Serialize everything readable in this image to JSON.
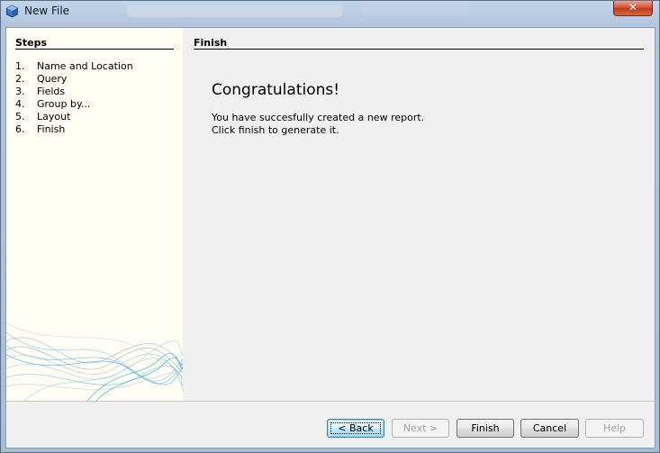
{
  "window": {
    "title": "New File",
    "close_symbol": "✕"
  },
  "steps": {
    "title": "Steps",
    "items": [
      {
        "num": "1.",
        "label": "Name and Location"
      },
      {
        "num": "2.",
        "label": "Query"
      },
      {
        "num": "3.",
        "label": "Fields"
      },
      {
        "num": "4.",
        "label": "Group by..."
      },
      {
        "num": "5.",
        "label": "Layout"
      },
      {
        "num": "6.",
        "label": "Finish"
      }
    ]
  },
  "content": {
    "title": "Finish",
    "heading": "Congratulations!",
    "line1": "You have succesfully created a new report.",
    "line2": "Click finish to generate it."
  },
  "buttons": {
    "back": "< Back",
    "next": "Next >",
    "finish": "Finish",
    "cancel": "Cancel",
    "help": "Help"
  }
}
